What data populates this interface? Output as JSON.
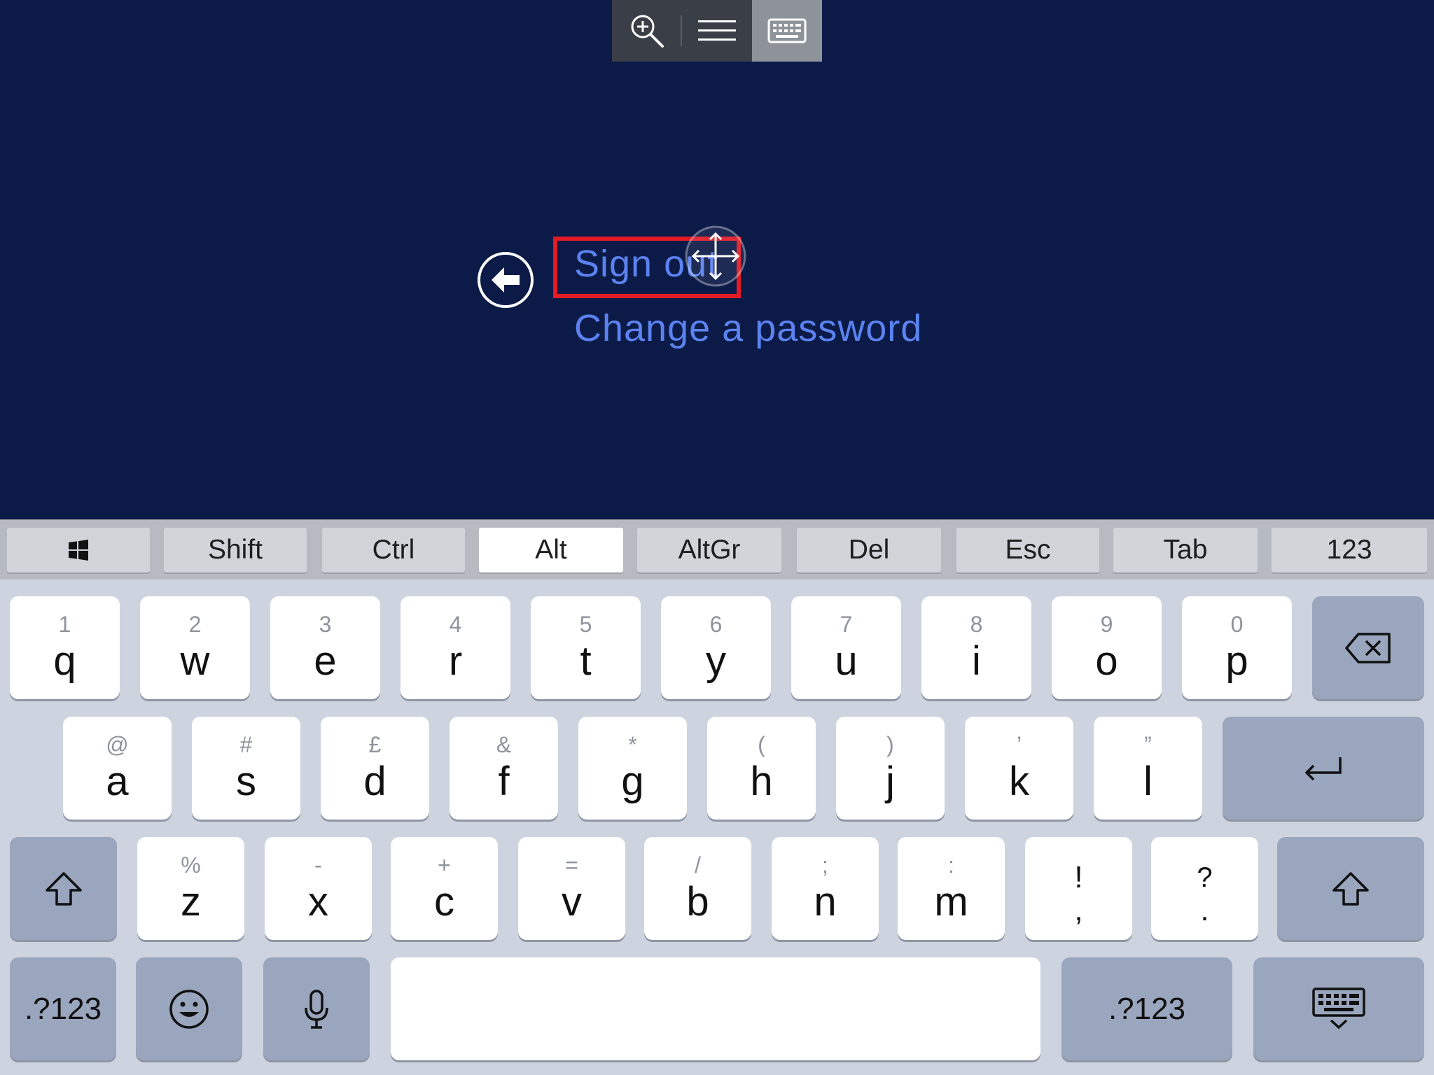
{
  "colors": {
    "screen_bg": "#0b1a47",
    "link": "#5b82f0",
    "highlight": "#e21b26",
    "keyboard_bg": "#cdd3df"
  },
  "toolbar": {
    "buttons": [
      {
        "icon": "zoom-in-icon"
      },
      {
        "icon": "menu-icon"
      },
      {
        "icon": "keyboard-icon",
        "active": true
      }
    ]
  },
  "menu": {
    "back_icon": "back-arrow-icon",
    "items": [
      {
        "label": "Sign out"
      },
      {
        "label": "Change a password"
      }
    ]
  },
  "modifier_bar": {
    "keys": [
      {
        "icon": "windows-icon",
        "label": ""
      },
      {
        "label": "Shift"
      },
      {
        "label": "Ctrl"
      },
      {
        "label": "Alt",
        "active": true
      },
      {
        "label": "AltGr"
      },
      {
        "label": "Del"
      },
      {
        "label": "Esc"
      },
      {
        "label": "Tab"
      },
      {
        "label": "123"
      }
    ]
  },
  "keyboard": {
    "row1": [
      {
        "p": "q",
        "s": "1"
      },
      {
        "p": "w",
        "s": "2"
      },
      {
        "p": "e",
        "s": "3"
      },
      {
        "p": "r",
        "s": "4"
      },
      {
        "p": "t",
        "s": "5"
      },
      {
        "p": "y",
        "s": "6"
      },
      {
        "p": "u",
        "s": "7"
      },
      {
        "p": "i",
        "s": "8"
      },
      {
        "p": "o",
        "s": "9"
      },
      {
        "p": "p",
        "s": "0"
      }
    ],
    "row2": [
      {
        "p": "a",
        "s": "@"
      },
      {
        "p": "s",
        "s": "#"
      },
      {
        "p": "d",
        "s": "£"
      },
      {
        "p": "f",
        "s": "&"
      },
      {
        "p": "g",
        "s": "*"
      },
      {
        "p": "h",
        "s": "("
      },
      {
        "p": "j",
        "s": ")"
      },
      {
        "p": "k",
        "s": "’"
      },
      {
        "p": "l",
        "s": "”"
      }
    ],
    "row3": [
      {
        "p": "z",
        "s": "%"
      },
      {
        "p": "x",
        "s": "-"
      },
      {
        "p": "c",
        "s": "+"
      },
      {
        "p": "v",
        "s": "="
      },
      {
        "p": "b",
        "s": "/"
      },
      {
        "p": "n",
        "s": ";"
      },
      {
        "p": "m",
        "s": ":"
      },
      {
        "p": ",",
        "s": "!"
      },
      {
        "p": ".",
        "s": "?"
      }
    ],
    "numbers_label": ".?123",
    "backspace_icon": "backspace-icon",
    "return_icon": "return-icon",
    "shift_icon": "shift-icon",
    "emoji_icon": "emoji-icon",
    "mic_icon": "microphone-icon",
    "hide_icon": "keyboard-hide-icon"
  }
}
